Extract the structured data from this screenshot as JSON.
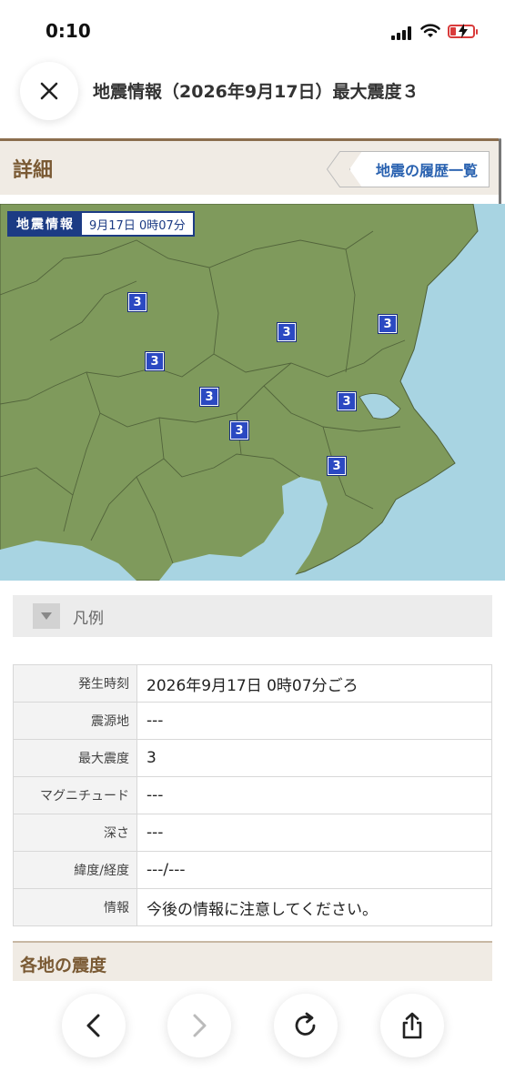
{
  "status_bar": {
    "time": "0:10"
  },
  "header": {
    "title": "地震情報（2026年9月17日）最大震度３"
  },
  "section": {
    "title": "詳細",
    "history_button": "地震の履歴一覧"
  },
  "map": {
    "badge_label": "地震情報",
    "badge_datetime": "9月17日 0時07分",
    "markers": [
      "3",
      "3",
      "3",
      "3",
      "3",
      "3",
      "3",
      "3"
    ]
  },
  "legend": {
    "label": "凡例"
  },
  "info": {
    "rows": [
      {
        "key": "発生時刻",
        "value": "2026年9月17日 0時07分ごろ"
      },
      {
        "key": "震源地",
        "value": "---"
      },
      {
        "key": "最大震度",
        "value": "3"
      },
      {
        "key": "マグニチュード",
        "value": "---"
      },
      {
        "key": "深さ",
        "value": "---"
      },
      {
        "key": "緯度/経度",
        "value": "---/---"
      },
      {
        "key": "情報",
        "value": "今後の情報に注意してください。"
      }
    ]
  },
  "section2": {
    "title": "各地の震度"
  },
  "colors": {
    "land": "#7f9a5c",
    "sea": "#a8d4e2",
    "marker": "#2b49c2",
    "accent_brown": "#7a5a34",
    "link_blue": "#2a62b0"
  }
}
